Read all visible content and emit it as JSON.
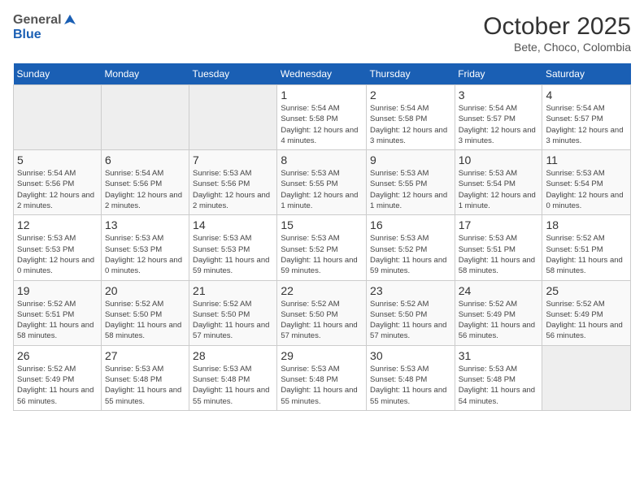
{
  "header": {
    "logo_general": "General",
    "logo_blue": "Blue",
    "title": "October 2025",
    "subtitle": "Bete, Choco, Colombia"
  },
  "weekdays": [
    "Sunday",
    "Monday",
    "Tuesday",
    "Wednesday",
    "Thursday",
    "Friday",
    "Saturday"
  ],
  "weeks": [
    [
      {
        "num": "",
        "empty": true
      },
      {
        "num": "",
        "empty": true
      },
      {
        "num": "",
        "empty": true
      },
      {
        "num": "1",
        "sunrise": "5:54 AM",
        "sunset": "5:58 PM",
        "daylight": "12 hours and 4 minutes."
      },
      {
        "num": "2",
        "sunrise": "5:54 AM",
        "sunset": "5:58 PM",
        "daylight": "12 hours and 3 minutes."
      },
      {
        "num": "3",
        "sunrise": "5:54 AM",
        "sunset": "5:57 PM",
        "daylight": "12 hours and 3 minutes."
      },
      {
        "num": "4",
        "sunrise": "5:54 AM",
        "sunset": "5:57 PM",
        "daylight": "12 hours and 3 minutes."
      }
    ],
    [
      {
        "num": "5",
        "sunrise": "5:54 AM",
        "sunset": "5:56 PM",
        "daylight": "12 hours and 2 minutes."
      },
      {
        "num": "6",
        "sunrise": "5:54 AM",
        "sunset": "5:56 PM",
        "daylight": "12 hours and 2 minutes."
      },
      {
        "num": "7",
        "sunrise": "5:53 AM",
        "sunset": "5:56 PM",
        "daylight": "12 hours and 2 minutes."
      },
      {
        "num": "8",
        "sunrise": "5:53 AM",
        "sunset": "5:55 PM",
        "daylight": "12 hours and 1 minute."
      },
      {
        "num": "9",
        "sunrise": "5:53 AM",
        "sunset": "5:55 PM",
        "daylight": "12 hours and 1 minute."
      },
      {
        "num": "10",
        "sunrise": "5:53 AM",
        "sunset": "5:54 PM",
        "daylight": "12 hours and 1 minute."
      },
      {
        "num": "11",
        "sunrise": "5:53 AM",
        "sunset": "5:54 PM",
        "daylight": "12 hours and 0 minutes."
      }
    ],
    [
      {
        "num": "12",
        "sunrise": "5:53 AM",
        "sunset": "5:53 PM",
        "daylight": "12 hours and 0 minutes."
      },
      {
        "num": "13",
        "sunrise": "5:53 AM",
        "sunset": "5:53 PM",
        "daylight": "12 hours and 0 minutes."
      },
      {
        "num": "14",
        "sunrise": "5:53 AM",
        "sunset": "5:53 PM",
        "daylight": "11 hours and 59 minutes."
      },
      {
        "num": "15",
        "sunrise": "5:53 AM",
        "sunset": "5:52 PM",
        "daylight": "11 hours and 59 minutes."
      },
      {
        "num": "16",
        "sunrise": "5:53 AM",
        "sunset": "5:52 PM",
        "daylight": "11 hours and 59 minutes."
      },
      {
        "num": "17",
        "sunrise": "5:53 AM",
        "sunset": "5:51 PM",
        "daylight": "11 hours and 58 minutes."
      },
      {
        "num": "18",
        "sunrise": "5:52 AM",
        "sunset": "5:51 PM",
        "daylight": "11 hours and 58 minutes."
      }
    ],
    [
      {
        "num": "19",
        "sunrise": "5:52 AM",
        "sunset": "5:51 PM",
        "daylight": "11 hours and 58 minutes."
      },
      {
        "num": "20",
        "sunrise": "5:52 AM",
        "sunset": "5:50 PM",
        "daylight": "11 hours and 58 minutes."
      },
      {
        "num": "21",
        "sunrise": "5:52 AM",
        "sunset": "5:50 PM",
        "daylight": "11 hours and 57 minutes."
      },
      {
        "num": "22",
        "sunrise": "5:52 AM",
        "sunset": "5:50 PM",
        "daylight": "11 hours and 57 minutes."
      },
      {
        "num": "23",
        "sunrise": "5:52 AM",
        "sunset": "5:50 PM",
        "daylight": "11 hours and 57 minutes."
      },
      {
        "num": "24",
        "sunrise": "5:52 AM",
        "sunset": "5:49 PM",
        "daylight": "11 hours and 56 minutes."
      },
      {
        "num": "25",
        "sunrise": "5:52 AM",
        "sunset": "5:49 PM",
        "daylight": "11 hours and 56 minutes."
      }
    ],
    [
      {
        "num": "26",
        "sunrise": "5:52 AM",
        "sunset": "5:49 PM",
        "daylight": "11 hours and 56 minutes."
      },
      {
        "num": "27",
        "sunrise": "5:53 AM",
        "sunset": "5:48 PM",
        "daylight": "11 hours and 55 minutes."
      },
      {
        "num": "28",
        "sunrise": "5:53 AM",
        "sunset": "5:48 PM",
        "daylight": "11 hours and 55 minutes."
      },
      {
        "num": "29",
        "sunrise": "5:53 AM",
        "sunset": "5:48 PM",
        "daylight": "11 hours and 55 minutes."
      },
      {
        "num": "30",
        "sunrise": "5:53 AM",
        "sunset": "5:48 PM",
        "daylight": "11 hours and 55 minutes."
      },
      {
        "num": "31",
        "sunrise": "5:53 AM",
        "sunset": "5:48 PM",
        "daylight": "11 hours and 54 minutes."
      },
      {
        "num": "",
        "empty": true
      }
    ]
  ],
  "labels": {
    "sunrise": "Sunrise:",
    "sunset": "Sunset:",
    "daylight": "Daylight:"
  }
}
